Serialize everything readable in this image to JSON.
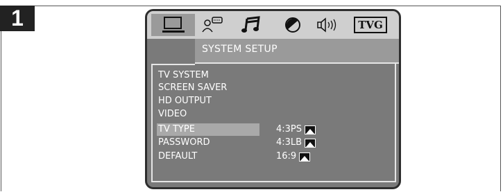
{
  "step": {
    "number": "1"
  },
  "osd": {
    "icons": [
      {
        "name": "system-setup-icon",
        "selected": true
      },
      {
        "name": "language-icon",
        "selected": false
      },
      {
        "name": "audio-icon",
        "selected": false
      },
      {
        "name": "video-icon",
        "selected": false
      },
      {
        "name": "speaker-icon",
        "selected": false
      },
      {
        "name": "tvg-icon",
        "label": "TVG",
        "selected": false
      }
    ],
    "tab_title": "SYSTEM SETUP",
    "menu": [
      {
        "label": "TV SYSTEM"
      },
      {
        "label": "SCREEN SAVER"
      },
      {
        "label": "HD OUTPUT"
      },
      {
        "label": "VIDEO"
      },
      {
        "label": "TV TYPE",
        "active": true
      },
      {
        "label": "PASSWORD"
      },
      {
        "label": "DEFAULT"
      }
    ],
    "options": [
      {
        "label": "4:3PS",
        "icon": "aspect-4-3ps-icon"
      },
      {
        "label": "4:3LB",
        "icon": "aspect-4-3lb-icon"
      },
      {
        "label": "16:9",
        "icon": "aspect-16-9-icon"
      }
    ],
    "colors": {
      "panel": "#7a7a7a",
      "iconbar": "#cfcfcf",
      "selected": "#9a9a9a",
      "highlight": "#a9a9a9",
      "text": "#ffffff"
    }
  }
}
